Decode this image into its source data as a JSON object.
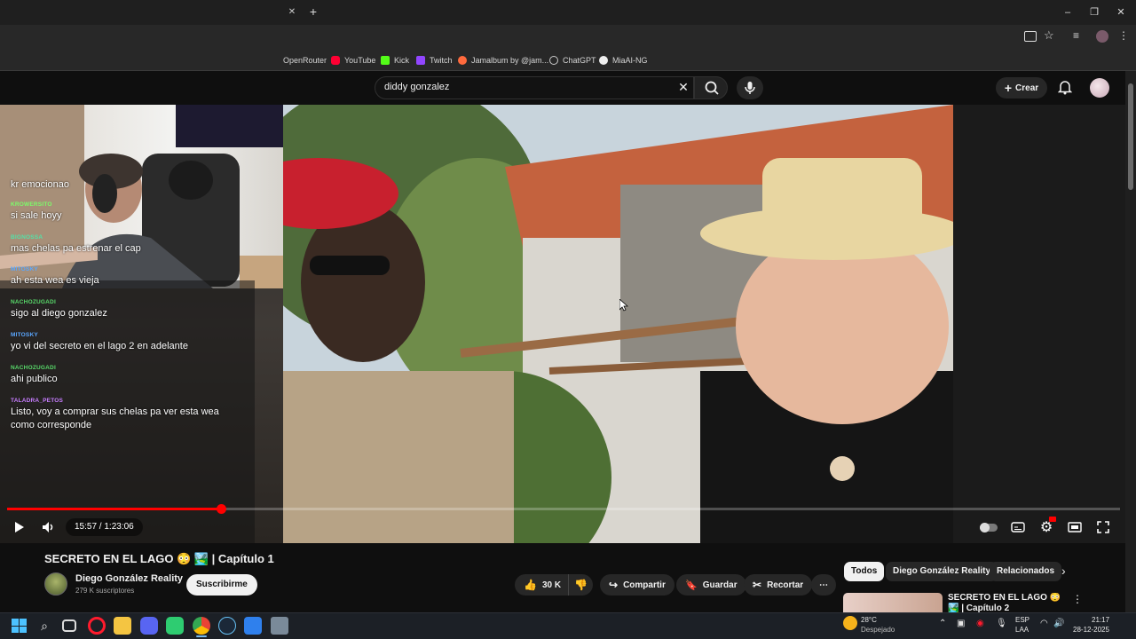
{
  "browser": {
    "bookmarks": [
      "OpenRouter",
      "YouTube",
      "Kick",
      "Twitch",
      "Jamalbum by @jam...",
      "ChatGPT",
      "MiaAI-NG"
    ]
  },
  "header": {
    "search_value": "diddy gonzalez",
    "create_label": "Crear"
  },
  "chat": {
    "messages": [
      {
        "user": "",
        "text": "kr emocionao",
        "color": "#ffffff"
      },
      {
        "user": "KROWERSITO",
        "text": "si sale hoyy",
        "color": "#7cfc6a"
      },
      {
        "user": "BIGNOSSA",
        "text": "mas chelas pa estrenar el cap",
        "color": "#55e0a6"
      },
      {
        "user": "MITOSKY",
        "text": "ah esta wea es vieja",
        "color": "#5aa7ff"
      },
      {
        "user": "NACHOZUGADI",
        "text": "sigo al diego gonzalez",
        "color": "#58d96a"
      },
      {
        "user": "MITOSKY",
        "text": "yo vi del secreto en el lago 2 en adelante",
        "color": "#5aa7ff"
      },
      {
        "user": "NACHOZUGADI",
        "text": "ahi publico",
        "color": "#58d96a"
      },
      {
        "user": "TALADRA_PETOS",
        "text": "Listo, voy a comprar sus chelas pa ver esta wea como corresponde",
        "color": "#c77dff"
      }
    ]
  },
  "player": {
    "timecode": "15:57 / 1:23:06",
    "progress": 0.1919
  },
  "video": {
    "title": "SECRETO EN EL LAGO 😳 🏞️ | Capítulo 1",
    "channel_name": "Diego González Reality",
    "channel_subs": "279 K suscriptores",
    "subscribe_label": "Suscribirme",
    "likes": "30 K",
    "share_label": "Compartir",
    "save_label": "Guardar",
    "clip_label": "Recortar"
  },
  "sidebar": {
    "chips": [
      "Todos",
      "Diego González Reality",
      "Relacionados"
    ],
    "recommendation_title": "SECRETO EN EL LAGO 😳 🏞️ | Capítulo 2"
  },
  "taskbar": {
    "weather_temp": "28°C",
    "weather_desc": "Despejado",
    "lang_top": "ESP",
    "lang_bottom": "LAA",
    "time": "21:17",
    "date": "28-12-2025"
  }
}
